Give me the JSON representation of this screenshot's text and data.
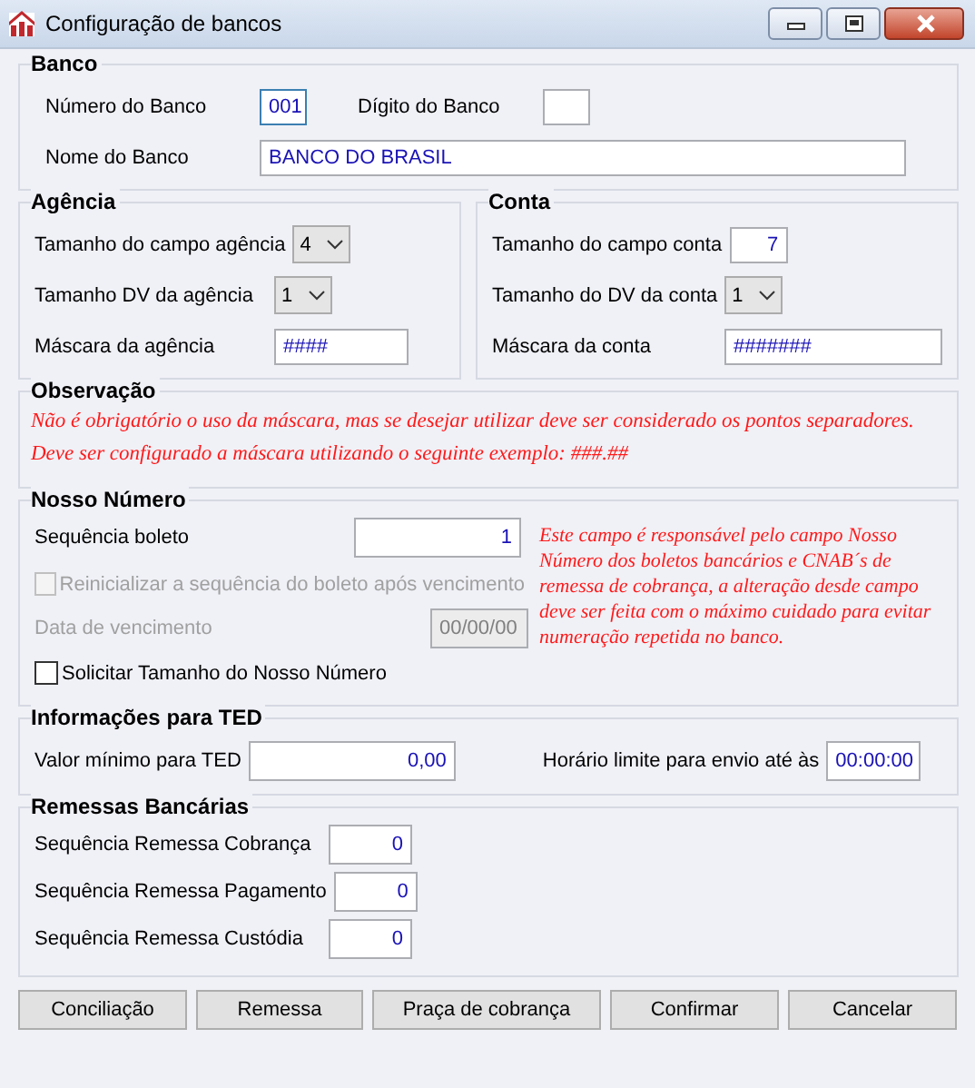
{
  "window": {
    "title": "Configuração de bancos"
  },
  "banco": {
    "title": "Banco",
    "numero": {
      "label": "Número do Banco",
      "value": "001",
      "focused": true
    },
    "digito": {
      "label": "Dígito do Banco"
    },
    "nome": {
      "label": "Nome do Banco",
      "value": "BANCO DO BRASIL"
    }
  },
  "agencia": {
    "title": "Agência",
    "rows": [
      {
        "kind": "combo",
        "label": "Tamanho do campo agência",
        "value": "4"
      },
      {
        "kind": "combo",
        "label": "Tamanho DV da agência",
        "value": "1"
      },
      {
        "kind": "text",
        "label": "Máscara da agência",
        "value": "####"
      }
    ]
  },
  "conta": {
    "title": "Conta",
    "rows": [
      {
        "kind": "number",
        "label": "Tamanho do campo conta",
        "value": "7"
      },
      {
        "kind": "combo",
        "label": "Tamanho do DV da conta",
        "value": "1"
      },
      {
        "kind": "text",
        "label": "Máscara da conta",
        "value": "#######"
      }
    ]
  },
  "observacao": {
    "title": "Observação",
    "lines": [
      "Não é obrigatório o uso da máscara, mas se desejar utilizar deve ser considerado os pontos separadores.",
      "Deve ser configurado a máscara utilizando o seguinte exemplo: ###.##"
    ]
  },
  "nosso_numero": {
    "title": "Nosso Número",
    "sequencia": {
      "label": "Sequência boleto",
      "value": "1"
    },
    "reinicializar": {
      "label": "Reinicializar a sequência do boleto após vencimento",
      "checked": false,
      "disabled": true
    },
    "vencimento": {
      "label": "Data de vencimento",
      "value": "00/00/00",
      "disabled": true
    },
    "solicitar": {
      "label": "Solicitar Tamanho do Nosso Número",
      "checked": false,
      "disabled": false
    },
    "note": "Este campo é responsável pelo campo Nosso Número dos boletos bancários e CNAB´s de remessa de cobrança, a alteração desde campo deve ser feita com o máximo cuidado para evitar numeração repetida no banco."
  },
  "ted": {
    "title": "Informações para TED",
    "valor": {
      "label": "Valor mínimo para TED",
      "value": "0,00"
    },
    "horario": {
      "label": "Horário limite para envio até às",
      "value": "00:00:00"
    }
  },
  "remessas": {
    "title": "Remessas Bancárias",
    "rows": [
      {
        "label": "Sequência Remessa Cobrança",
        "value": "0"
      },
      {
        "label": "Sequência Remessa Pagamento",
        "value": "0"
      },
      {
        "label": "Sequência Remessa Custódia",
        "value": "0"
      }
    ]
  },
  "buttons": [
    "Conciliação",
    "Remessa",
    "Praça de cobrança",
    "Confirmar",
    "Cancelar"
  ]
}
